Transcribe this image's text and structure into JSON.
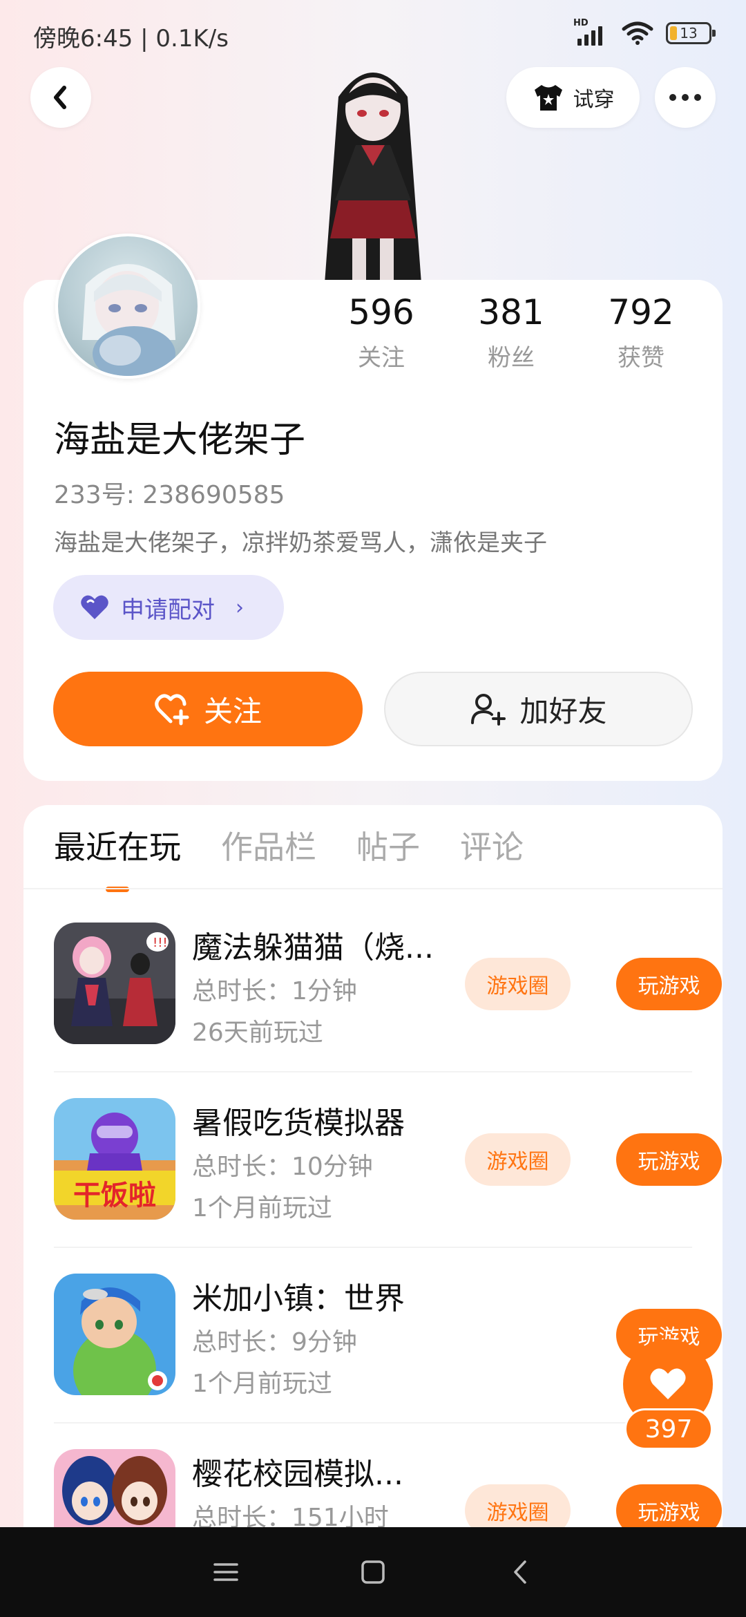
{
  "status": {
    "time_speed": "傍晚6:45 | 0.1K/s",
    "hd": "HD",
    "battery": "13"
  },
  "header": {
    "tryon_label": "试穿"
  },
  "profile": {
    "stats": [
      {
        "value": "596",
        "label": "关注"
      },
      {
        "value": "381",
        "label": "粉丝"
      },
      {
        "value": "792",
        "label": "获赞"
      }
    ],
    "username": "海盐是大佬架子",
    "user_id": "233号: 238690585",
    "bio": "海盐是大佬架子，凉拌奶茶爱骂人，潇依是夹子",
    "pair_label": "申请配对",
    "follow_label": "关注",
    "add_friend_label": "加好友"
  },
  "tabs": [
    "最近在玩",
    "作品栏",
    "帖子",
    "评论"
  ],
  "games": [
    {
      "title": "魔法躲猫猫（烧...",
      "duration": "总时长：1分钟",
      "last_played": "26天前玩过",
      "circle_label": "游戏圈",
      "play_label": "玩游戏"
    },
    {
      "title": "暑假吃货模拟器",
      "duration": "总时长：10分钟",
      "last_played": "1个月前玩过",
      "circle_label": "游戏圈",
      "play_label": "玩游戏",
      "thumb_text": "干饭啦"
    },
    {
      "title": "米加小镇：世界",
      "duration": "总时长：9分钟",
      "last_played": "1个月前玩过",
      "circle_label": "",
      "play_label": "玩游戏"
    },
    {
      "title": "樱花校园模拟...",
      "duration": "总时长：151小时",
      "last_played": "",
      "circle_label": "游戏圈",
      "play_label": "玩游戏"
    }
  ],
  "like_float": {
    "count": "397"
  },
  "colors": {
    "accent": "#ff7411",
    "pair_bg": "#e9e8fb",
    "pair_text": "#5b55c8"
  },
  "icons": [
    "back-arrow",
    "tshirt",
    "more-dots",
    "purple-heart",
    "heart-plus",
    "user-plus",
    "heart",
    "menu",
    "home-square",
    "back-chevron"
  ]
}
